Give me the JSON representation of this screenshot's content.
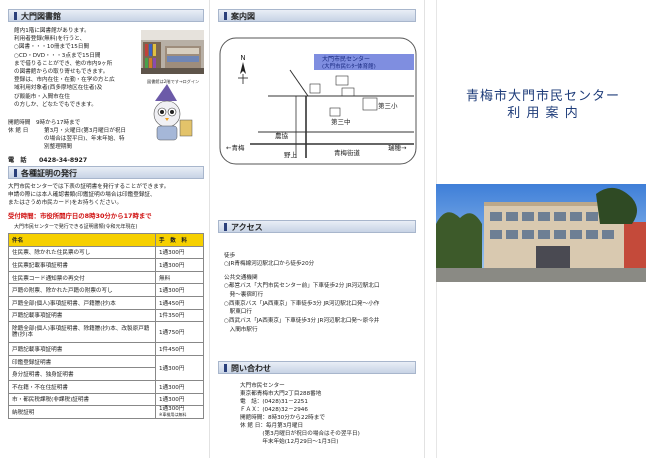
{
  "library": {
    "heading": "大門図書館",
    "lines": [
      "館内1階に図書館があります。",
      "利用者登録(無料)を行うと、",
      "○図書・・・10冊まで15日間",
      "○CD・DVD・・・3点まで15日間",
      "まで借りることができ、他の市内9ヶ所",
      "の図書館からの取り寄せもできます。",
      "登録は、市内在住・在勤・在学の方と広",
      "域利用対象者(西多摩地区在住者)及",
      "び飯能市・入間市在住",
      "の方しか、どなたでもできます。"
    ],
    "caption": "図書館は2階です→ログイン",
    "hours_label": "開館時間",
    "hours_value": "9時から17時まで",
    "closed_label": "休 館 日",
    "closed_lines": [
      "第3月・火曜日(第3月曜日が祝日",
      "の場合は翌平日)、年末年始、特",
      "別整理期間"
    ],
    "phone_label": "電　話",
    "phone_value": "0428-34-8927"
  },
  "certificates": {
    "heading": "各種証明の発行",
    "intro": [
      "大門市民センターでは下表の証明書を発行することができます。",
      "申請の際には本人確認書類(印鑑証明の場合は印鑑登録証、",
      "またはさうめ市民カード)をお持ちください。"
    ],
    "notice": "受付時間：市役所開庁日の8時30分から17時まで",
    "table_caption": "大門市民センターで発行できる証明書類(令和元年現在)",
    "table_header": {
      "name": "件名",
      "fee": "手　数　料"
    },
    "rows": [
      {
        "name": "住民票、除かれた住民票の写し",
        "fee": "1通300円"
      },
      {
        "name": "住民票記載事項証明書",
        "fee": "1通300円"
      },
      {
        "name": "住民票コード通知票の再交付",
        "fee": "無料"
      },
      {
        "name": "戸籍の附票、除かれた戸籍の附票の写し",
        "fee": "1通300円"
      },
      {
        "name": "戸籍全部(個人)事項証明書、戸籍謄(抄)本",
        "fee": "1通450円"
      },
      {
        "name": "戸籍記載事項証明書",
        "fee": "1件350円"
      },
      {
        "name": "除籍全部(個人)事項証明書、除籍謄(抄)本、改製原戸籍謄(抄)本",
        "fee": "1通750円"
      },
      {
        "name": "戸籍記載事項証明書",
        "fee": "1件450円"
      },
      {
        "name": "印鑑登録証明書",
        "fee": ""
      },
      {
        "name": "身分証明書、独身証明書",
        "fee": "1通300円"
      },
      {
        "name": "不在籍・不在住証明書",
        "fee": "1通300円"
      },
      {
        "name": "市・都民税課税(非課税)証明書",
        "fee": "1通300円"
      },
      {
        "name": "納税証明",
        "fee": "1通300円"
      }
    ],
    "last_fee_note": "※車検用は無料"
  },
  "map": {
    "heading": "案内図",
    "center_label_1": "大門市民センター",
    "center_label_2": "(大門市民ｾﾝﾀｰ体育館)",
    "north": "N",
    "school1": "第三小",
    "school2": "第三中",
    "farm": "農協",
    "stop": "野上",
    "ome": "←青梅",
    "street": "青梅街道",
    "mizuho": "瑞穂→"
  },
  "access": {
    "heading": "アクセス",
    "walk_title": "徒歩",
    "walk_line": "○JR青梅線河辺駅北口から徒歩20分",
    "bus_title": "公共交通機関",
    "bus_lines": [
      "○都営バス「大門市民センター前」下車徒歩2分 JR河辺駅北口",
      "　発～裏宿町行",
      "○西東京バス「JA西東京」下車徒歩3分 JR河辺駅北口発～小作",
      "　駅東口行",
      "○西武バス「JA西東京」下車徒歩3分 JR河辺駅北口発～原今井",
      "　入間市駅行"
    ]
  },
  "contact": {
    "heading": "問い合わせ",
    "lines": [
      "大門市民センター",
      "東京都青梅市大門2丁目288番地",
      "電　話：(0428)31－2251",
      "ＦＡＸ：(0428)32－2946",
      "開館時間：8時30分から22時まで",
      "休 館 日：毎月第3月曜日",
      "　　　　(第3月曜日が祝日の場合はその翌平日)",
      "　　　　年末年始(12月29日～1月3日)"
    ]
  },
  "cover": {
    "title": "青梅市大門市民センター",
    "subtitle": "利 用 案 内"
  },
  "colors": {
    "header_bar": "#c7d3e5",
    "table_header": "#f6d000",
    "notice_red": "#d01010",
    "title_blue": "#1f3d7a",
    "map_highlight": "#7f8ee0"
  }
}
